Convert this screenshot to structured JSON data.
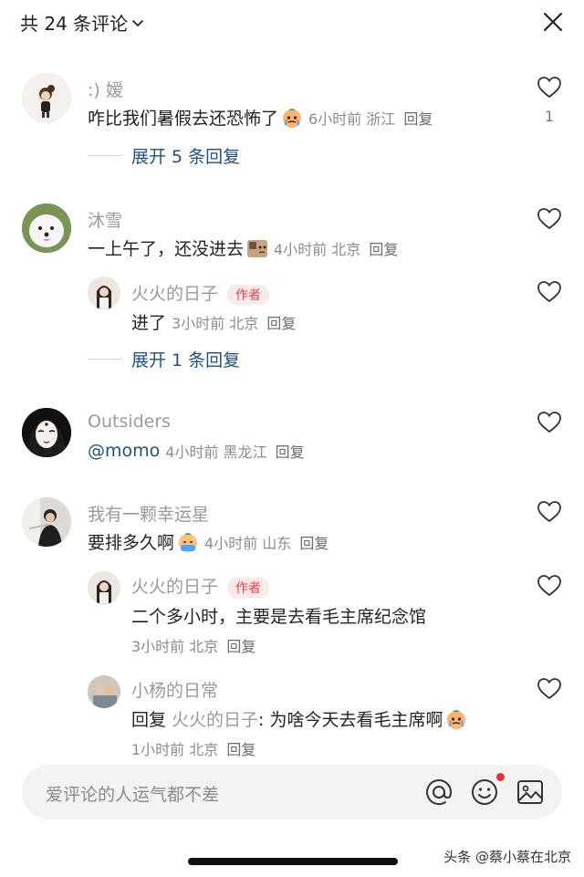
{
  "header": {
    "title": "共 24 条评论"
  },
  "comments": [
    {
      "name": ":) 嫒",
      "text": "咋比我们暑假去还恐怖了",
      "time": "6小时前",
      "location": "浙江",
      "reply_label": "回复",
      "likes": "1",
      "expand": "展开 5 条回复"
    },
    {
      "name": "沐雪",
      "text": "一上午了，还没进去",
      "time": "4小时前",
      "location": "北京",
      "reply_label": "回复",
      "reply": {
        "name": "火火的日子",
        "tag": "作者",
        "text": "进了",
        "time": "3小时前",
        "location": "北京",
        "reply_label": "回复"
      },
      "expand": "展开 1 条回复"
    },
    {
      "name": "Outsiders",
      "text": "@momo",
      "time": "4小时前",
      "location": "黑龙江",
      "reply_label": "回复"
    },
    {
      "name": "我有一颗幸运星",
      "text": "要排多久啊",
      "time": "4小时前",
      "location": "山东",
      "reply_label": "回复",
      "replies": [
        {
          "name": "火火的日子",
          "tag": "作者",
          "text": "二个多小时，主要是去看毛主席纪念馆",
          "time": "3小时前",
          "location": "北京",
          "reply_label": "回复"
        },
        {
          "name": "小杨的日常",
          "prefix": "回复",
          "reply_to": "火火的日子",
          "text": ": 为啥今天去看毛主席啊",
          "time": "1小时前",
          "location": "北京",
          "reply_label": "回复"
        }
      ]
    }
  ],
  "input": {
    "placeholder": "爱评论的人运气都不差"
  },
  "icons": {
    "mention": "at-icon",
    "emoji": "smiley-icon",
    "image": "image-icon",
    "like": "heart-icon",
    "close": "close-icon"
  },
  "colors": {
    "link": "#1f4f8a",
    "author_tag": "#e5404f",
    "notification_dot": "#ee2b3b"
  },
  "watermark": "头条 @蔡小蔡在北京"
}
